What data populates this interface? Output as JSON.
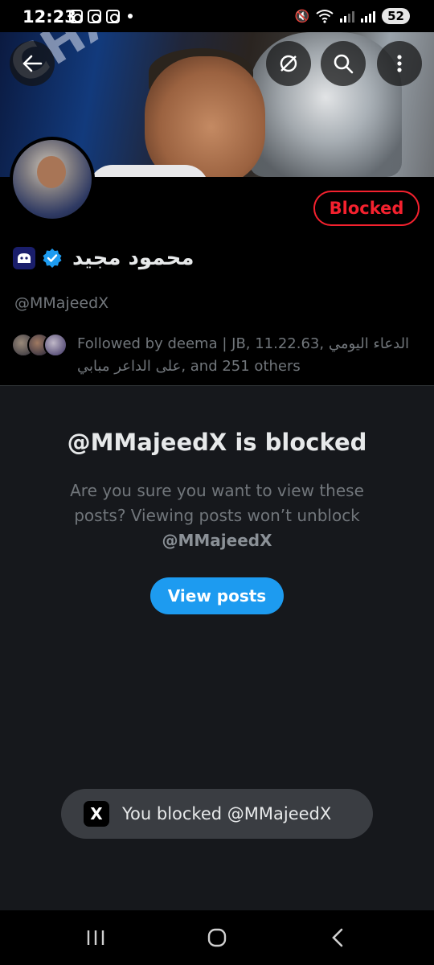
{
  "status_bar": {
    "time": "12:23",
    "battery": "52"
  },
  "header": {
    "banner_text": "CHAMPIO",
    "back_icon": "arrow-left-icon",
    "grok_icon": "grok-icon",
    "search_icon": "search-icon",
    "more_icon": "more-vertical-icon"
  },
  "profile": {
    "blocked_label": "Blocked",
    "display_name": "محمود مجيد",
    "handle": "@MMajeedX",
    "followed_by": "Followed by deema | JB, 11.22.63, الدعاء اليومي",
    "followed_by_cont": "على الداعر مبابي, and 251 others",
    "verified_color": "#1d9bf0"
  },
  "blocked_panel": {
    "title": "@MMajeedX is blocked",
    "description": "Are you sure you want to view these posts? Viewing posts won’t unblock",
    "description_handle": "@MMajeedX",
    "view_button": "View posts"
  },
  "toast": {
    "logo": "X",
    "text": "You blocked @MMajeedX"
  },
  "colors": {
    "accent": "#1d9bf0",
    "danger": "#f4212e",
    "muted": "#71767b"
  }
}
